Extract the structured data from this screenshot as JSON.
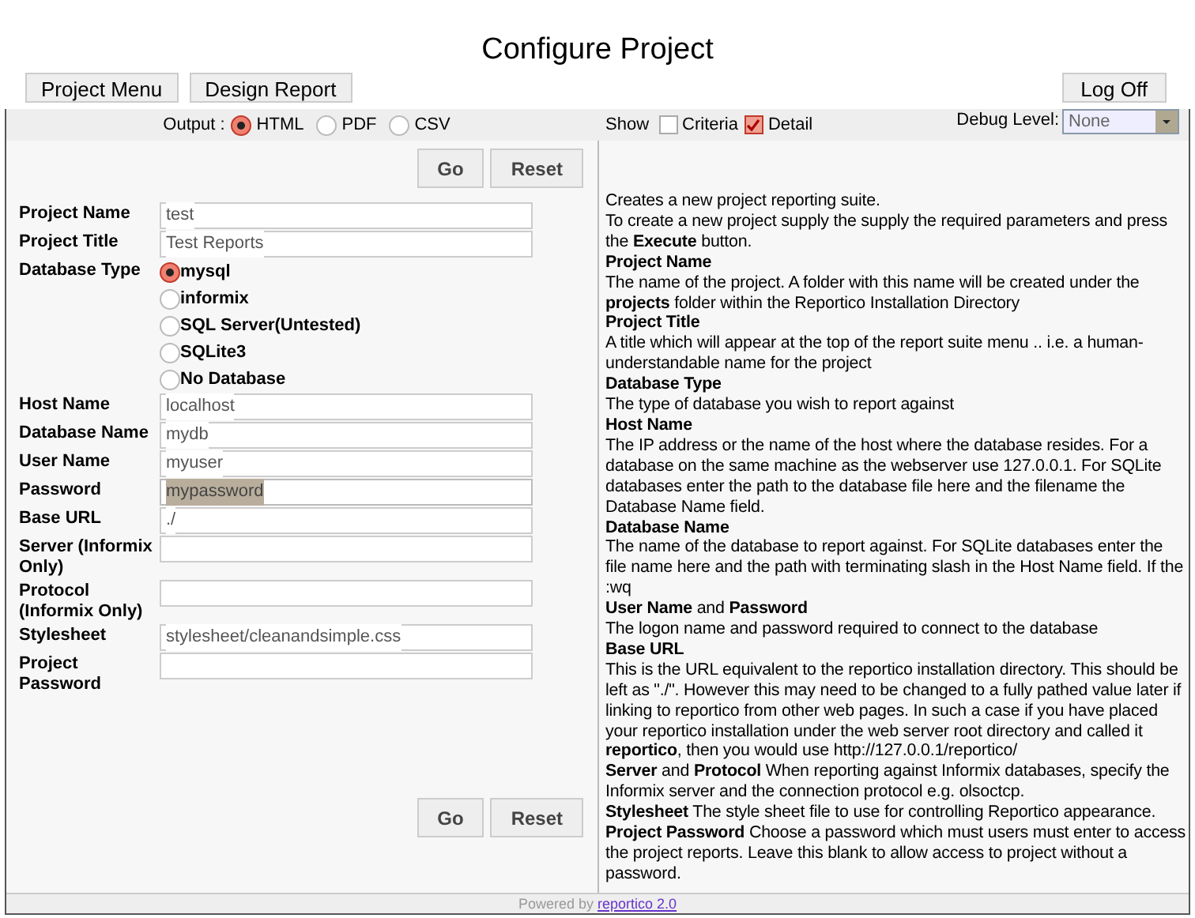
{
  "title": "Configure Project",
  "nav_buttons": [
    "Project Menu",
    "Design Report"
  ],
  "logoff_button": "Log Off",
  "output": {
    "label": "Output :",
    "options": [
      {
        "label": "HTML",
        "selected": true
      },
      {
        "label": "PDF",
        "selected": false
      },
      {
        "label": "CSV",
        "selected": false
      }
    ]
  },
  "show": {
    "label": "Show",
    "options": [
      {
        "label": "Criteria",
        "checked": false
      },
      {
        "label": "Detail",
        "checked": true
      }
    ]
  },
  "debug": {
    "label": "Debug Level:",
    "value": "None"
  },
  "actions_top": [
    "Go",
    "Reset"
  ],
  "actions_bottom": [
    "Go",
    "Reset"
  ],
  "form": [
    {
      "kind": "text",
      "label": "Project Name",
      "value": "test",
      "highlighted": false
    },
    {
      "kind": "text",
      "label": "Project Title",
      "value": "Test Reports",
      "highlighted": false
    },
    {
      "kind": "radio",
      "label": "Database Type",
      "options": [
        {
          "label": "mysql",
          "selected": true
        },
        {
          "label": "informix",
          "selected": false
        },
        {
          "label": "SQL Server(Untested)",
          "selected": false
        },
        {
          "label": "SQLite3",
          "selected": false
        },
        {
          "label": "No Database",
          "selected": false
        }
      ]
    },
    {
      "kind": "text",
      "label": "Host Name",
      "value": "localhost",
      "highlighted": false
    },
    {
      "kind": "text",
      "label": "Database Name",
      "value": "mydb",
      "highlighted": false
    },
    {
      "kind": "text",
      "label": "User Name",
      "value": "myuser",
      "highlighted": false
    },
    {
      "kind": "text",
      "label": "Password",
      "value": "mypassword",
      "highlighted": true
    },
    {
      "kind": "text",
      "label": "Base URL",
      "value": "./",
      "highlighted": false
    },
    {
      "kind": "text",
      "label": "Server (Informix Only)"
    },
    {
      "kind": "text",
      "label": "Protocol (Informix Only)"
    },
    {
      "kind": "text",
      "label": "Stylesheet",
      "value": "stylesheet/cleanandsimple.css",
      "highlighted": false
    },
    {
      "kind": "text",
      "label": "Project Password"
    }
  ],
  "help": [
    {
      "kind": "text",
      "text": "Creates a new project reporting suite."
    },
    {
      "kind": "text",
      "text": "To create a new project supply the supply the required parameters and press the **Execute** button."
    },
    {
      "kind": "heading",
      "text": "Project Name"
    },
    {
      "kind": "text",
      "text": "The name of the project. A folder with this name will be created under the **projects** folder within the Reportico Installation Directory"
    },
    {
      "kind": "heading",
      "text": "Project Title"
    },
    {
      "kind": "text",
      "text": "A title which will appear at the top of the report suite menu .. i.e. a human-understandable name for the project"
    },
    {
      "kind": "heading",
      "text": "Database Type"
    },
    {
      "kind": "text",
      "text": "The type of database you wish to report against"
    },
    {
      "kind": "heading",
      "text": "Host Name"
    },
    {
      "kind": "text",
      "text": "The IP address or the name of the host where the database resides. For a database on the same machine as the webserver use 127.0.0.1. For SQLite databases enter the path to the database file here and the filename the Database Name field."
    },
    {
      "kind": "heading",
      "text": "Database Name"
    },
    {
      "kind": "text",
      "text": "The name of the database to report against. For SQLite databases enter the file name here and the path with terminating slash in the Host Name field. If the :wq"
    },
    {
      "kind": "text",
      "text": "**User Name** and **Password**"
    },
    {
      "kind": "text",
      "text": "The logon name and password required to connect to the database"
    },
    {
      "kind": "heading",
      "text": "Base URL"
    },
    {
      "kind": "text",
      "text": "This is the URL equivalent to the reportico installation directory. This should be left as \"./\". However this may need to be changed to a fully pathed value later if linking to reportico from other web pages. In such a case if you have placed your reportico installation under the web server root directory and called it **reportico**, then you would use http://127.0.0.1/reportico/"
    },
    {
      "kind": "text",
      "text": "**Server** and **Protocol** When reporting against Informix databases, specify the Informix server and the connection protocol e.g. olsoctcp."
    },
    {
      "kind": "text",
      "text": "**Stylesheet** The style sheet file to use for controlling Reportico appearance."
    },
    {
      "kind": "text",
      "text": "**Project Password** Choose a password which must users must enter to access the project reports. Leave this blank to allow access to project without a password."
    }
  ],
  "footer": {
    "text": "Powered by",
    "link": "reportico 2.0"
  }
}
